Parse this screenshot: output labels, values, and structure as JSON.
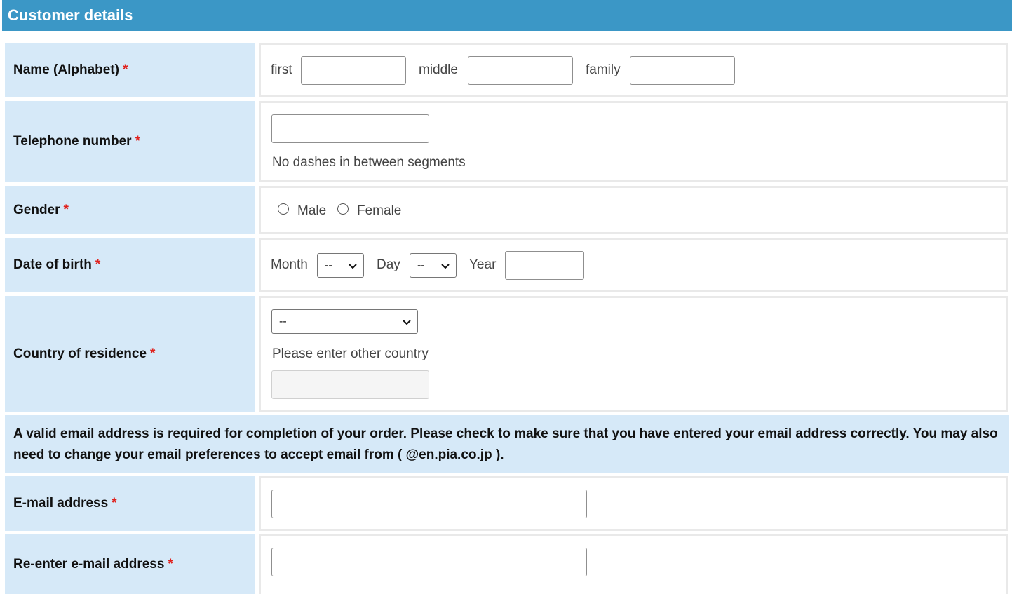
{
  "header": {
    "title": "Customer details"
  },
  "required_marker": "*",
  "name_row": {
    "label": "Name (Alphabet)",
    "first_label": "first",
    "first_value": "",
    "middle_label": "middle",
    "middle_value": "",
    "family_label": "family",
    "family_value": ""
  },
  "phone_row": {
    "label": "Telephone number",
    "value": "",
    "hint": "No dashes in between segments"
  },
  "gender_row": {
    "label": "Gender",
    "options": [
      "Male",
      "Female"
    ],
    "selected": ""
  },
  "dob_row": {
    "label": "Date of birth",
    "month_label": "Month",
    "month_value": "--",
    "day_label": "Day",
    "day_value": "--",
    "year_label": "Year",
    "year_value": ""
  },
  "country_row": {
    "label": "Country of residence",
    "selected": "--",
    "other_hint": "Please enter other country",
    "other_value": ""
  },
  "notice": "A valid email address is required for completion of your order. Please check to make sure that you have entered your email address correctly. You may also need to change your email preferences to accept email from ( @en.pia.co.jp ).",
  "email_row": {
    "label": "E-mail address",
    "value": ""
  },
  "reemail_row": {
    "label": "Re-enter e-mail address",
    "value": ""
  }
}
